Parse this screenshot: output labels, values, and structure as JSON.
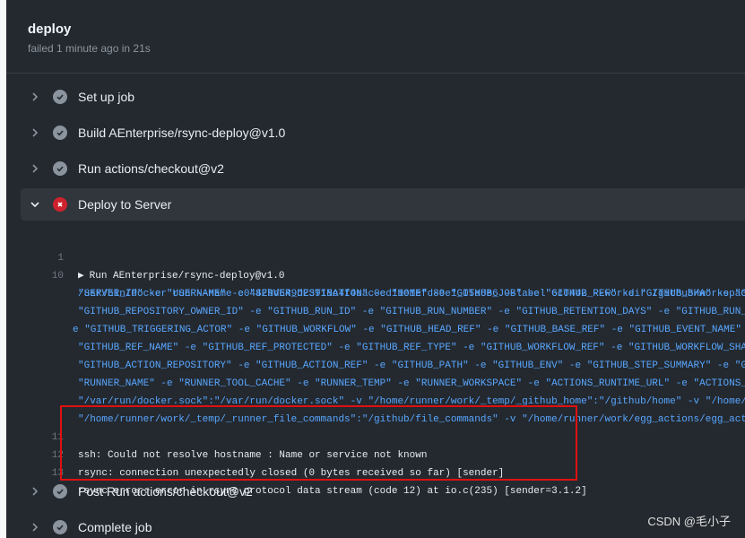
{
  "job": {
    "title": "deploy",
    "status": "failed 1 minute ago in 21s"
  },
  "steps": [
    {
      "label": "Set up job",
      "status": "success"
    },
    {
      "label": "Build AEnterprise/rsync-deploy@v1.0",
      "status": "success"
    },
    {
      "label": "Run actions/checkout@v2",
      "status": "success"
    },
    {
      "label": "Deploy to Server",
      "status": "failed"
    },
    {
      "label": "Post Run actions/checkout@v2",
      "status": "success"
    },
    {
      "label": "Complete job",
      "status": "success"
    }
  ],
  "log": {
    "group_line_number": "1",
    "group_title": "Run AEnterprise/rsync-deploy@v1.0",
    "line10_number": "10",
    "docker_lines": [
      "/usr/bin/docker run --name c0442bd649d23918c4f4eac0cd11e1efd89e1_05a8e6 --label 6c0442 --workdir /github/workspac",
      "\"SERVER_IP\" -e \"USERNAME\" -e \"SERVER_DESTINATION\" -e \"HOME\" -e \"GITHUB_JOB\" -e \"GITHUB_REF\" -e \"GITHUB_SHA\" -e \"G",
      "\"GITHUB_REPOSITORY_OWNER_ID\" -e \"GITHUB_RUN_ID\" -e \"GITHUB_RUN_NUMBER\" -e \"GITHUB_RETENTION_DAYS\" -e \"GITHUB_RUN_",
      "e \"GITHUB_TRIGGERING_ACTOR\" -e \"GITHUB_WORKFLOW\" -e \"GITHUB_HEAD_REF\" -e \"GITHUB_BASE_REF\" -e \"GITHUB_EVENT_NAME\"",
      "\"GITHUB_REF_NAME\" -e \"GITHUB_REF_PROTECTED\" -e \"GITHUB_REF_TYPE\" -e \"GITHUB_WORKFLOW_REF\" -e \"GITHUB_WORKFLOW_SHA",
      "\"GITHUB_ACTION_REPOSITORY\" -e \"GITHUB_ACTION_REF\" -e \"GITHUB_PATH\" -e \"GITHUB_ENV\" -e \"GITHUB_STEP_SUMMARY\" -e \"G",
      "\"RUNNER_NAME\" -e \"RUNNER_TOOL_CACHE\" -e \"RUNNER_TEMP\" -e \"RUNNER_WORKSPACE\" -e \"ACTIONS_RUNTIME_URL\" -e \"ACTIONS_",
      "\"/var/run/docker.sock\":\"/var/run/docker.sock\" -v \"/home/runner/work/_temp/_github_home\":\"/github/home\" -v \"/home/",
      "\"/home/runner/work/_temp/_runner_file_commands\":\"/github/file_commands\" -v \"/home/runner/work/egg_actions/egg_act"
    ],
    "error_lines": [
      {
        "number": "11",
        "text": "ssh: Could not resolve hostname : Name or service not known"
      },
      {
        "number": "12",
        "text": "rsync: connection unexpectedly closed (0 bytes received so far) [sender]"
      },
      {
        "number": "13",
        "text": "rsync error: error in rsync protocol data stream (code 12) at io.c(235) [sender=3.1.2]"
      }
    ]
  },
  "watermark": "CSDN @毛小子"
}
